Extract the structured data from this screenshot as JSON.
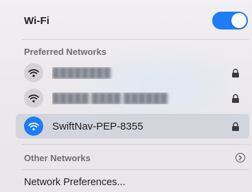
{
  "wifi": {
    "title": "Wi-Fi",
    "enabled": true,
    "accent_color": "#1f7cf5"
  },
  "preferred": {
    "header": "Preferred Networks",
    "networks": [
      {
        "name": "████████",
        "redacted": true,
        "secured": true,
        "icon": "wifi-icon",
        "connected": false
      },
      {
        "name": "█████ ████ ██████",
        "redacted": true,
        "secured": true,
        "icon": "wifi-icon",
        "connected": false
      },
      {
        "name": "SwiftNav-PEP-8355",
        "redacted": false,
        "secured": true,
        "icon": "wifi-icon",
        "connected": true
      }
    ]
  },
  "other": {
    "label": "Other Networks",
    "icon": "chevron-right-circle-icon"
  },
  "footer": {
    "preferences_label": "Network Preferences..."
  }
}
